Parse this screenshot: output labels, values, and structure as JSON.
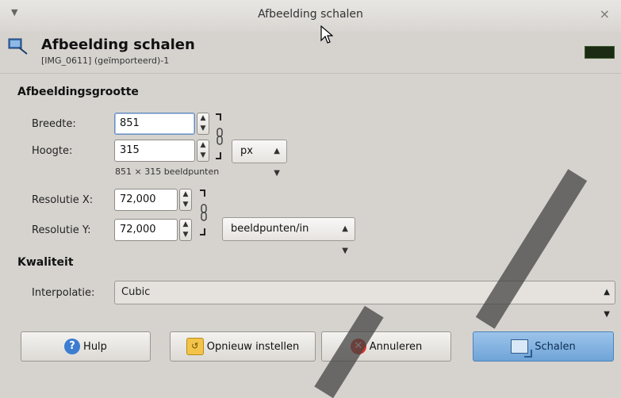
{
  "window": {
    "title": "Afbeelding schalen"
  },
  "header": {
    "title": "Afbeelding schalen",
    "subtitle": "[IMG_0611] (geïmporteerd)-1"
  },
  "image_size": {
    "heading": "Afbeeldingsgrootte",
    "width_label": "Breedte:",
    "width_value": "851",
    "height_label": "Hoogte:",
    "height_value": "315",
    "unit": "px",
    "dimensions_text": "851 × 315 beeldpunten",
    "res_x_label": "Resolutie X:",
    "res_x_value": "72,000",
    "res_y_label": "Resolutie Y:",
    "res_y_value": "72,000",
    "res_unit": "beeldpunten/in"
  },
  "quality": {
    "heading": "Kwaliteit",
    "interp_label": "Interpolatie:",
    "interp_value": "Cubic"
  },
  "buttons": {
    "help": "Hulp",
    "reset": "Opnieuw instellen",
    "cancel": "Annuleren",
    "scale": "Schalen"
  }
}
